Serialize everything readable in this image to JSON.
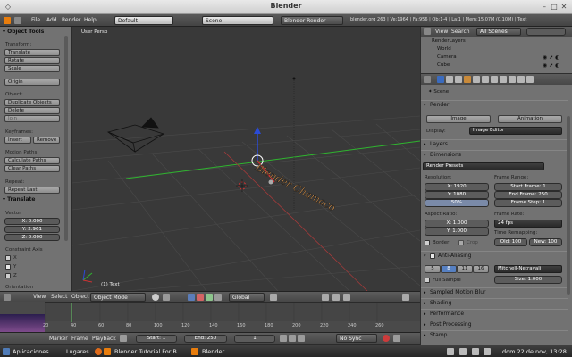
{
  "window": {
    "title": "Blender"
  },
  "info_header": {
    "menus": [
      "File",
      "Add",
      "Render",
      "Help"
    ],
    "layout": "Default",
    "scene": "Scene",
    "engine": "Blender Render",
    "stats": "blender.org 263 | Ve:1964 | Fa:956 | Ob:1-4 | La:1 | Mem:15.07M (0.10M) | Text"
  },
  "tool_panel": {
    "header": "Object Tools",
    "transform_label": "Transform:",
    "transform_buttons": [
      "Translate",
      "Rotate",
      "Scale"
    ],
    "origin_button": "Origin",
    "object_label": "Object:",
    "object_buttons": [
      "Duplicate Objects",
      "Delete",
      "Join"
    ],
    "keyframes_label": "Keyframes:",
    "keyframe_insert": "Insert",
    "keyframe_remove": "Remove",
    "motion_label": "Motion Paths:",
    "motion_calc": "Calculate Paths",
    "motion_clear": "Clear Paths",
    "repeat_label": "Repeat:",
    "repeat_last": "Repeat Last",
    "translate_header": "Translate",
    "vector_label": "Vector",
    "vector_x": "X: 0.000",
    "vector_y": "Y: 2.961",
    "vector_z": "Z: 0.000",
    "constraint_label": "Constraint Axis",
    "axes": [
      "X",
      "Y",
      "Z"
    ],
    "orientation_label": "Orientation"
  },
  "viewport": {
    "label": "User Persp",
    "object_label": "(1) Text",
    "text_object": "Blender Chamaco"
  },
  "viewport_header": {
    "view": "View",
    "select": "Select",
    "object": "Object",
    "mode": "Object Mode",
    "orientation": "Global"
  },
  "timeline": {
    "ticks": [
      "20",
      "40",
      "60",
      "80",
      "100",
      "120",
      "140",
      "160",
      "180",
      "200",
      "220",
      "240",
      "260"
    ],
    "marker": "Marker",
    "frame": "Frame",
    "playback": "Playback",
    "start": "Start: 1",
    "end": "End: 250",
    "current": "1",
    "sync": "No Sync"
  },
  "outliner": {
    "view": "View",
    "search": "Search",
    "filter": "All Scenes",
    "items": [
      "RenderLayers",
      "World",
      "Camera",
      "Cube"
    ]
  },
  "properties": {
    "context": "Scene",
    "render_header": "Render",
    "image_button": "Image",
    "animation_button": "Animation",
    "display_label": "Display:",
    "display_value": "Image Editor",
    "layers_header": "Layers",
    "dimensions_header": "Dimensions",
    "presets": "Render Presets",
    "resolution_label": "Resolution:",
    "res_x": "X: 1920",
    "res_y": "Y: 1080",
    "res_pct": "50%",
    "frame_range_label": "Frame Range:",
    "start_frame": "Start Frame: 1",
    "end_frame": "End Frame: 250",
    "frame_step": "Frame Step: 1",
    "aspect_label": "Aspect Ratio:",
    "aspect_x": "X: 1.000",
    "aspect_y": "Y: 1.000",
    "frame_rate_label": "Frame Rate:",
    "fps": "24 fps",
    "time_remap_label": "Time Remapping:",
    "old": "Old: 100",
    "new": "New: 100",
    "border": "Border",
    "crop": "Crop",
    "aa_header": "Anti-Aliasing",
    "aa_samples": [
      "5",
      "8",
      "11",
      "16"
    ],
    "aa_filter": "Mitchell-Netravali",
    "full_sample": "Full Sample",
    "size": "Size: 1.000",
    "sampled_mb": "Sampled Motion Blur",
    "shading": "Shading",
    "performance": "Performance",
    "post_processing": "Post Processing",
    "stamp": "Stamp"
  },
  "taskbar": {
    "apps": "Aplicaciones",
    "places": "Lugares",
    "task1": "Blender Tutorial For B...",
    "task2": "Blender",
    "clock": "dom 22 de nov, 13:28"
  },
  "colors": {
    "grid_y": "#3ec23e",
    "grid_x": "#c23e3e",
    "text_object": "#e8a35a"
  }
}
